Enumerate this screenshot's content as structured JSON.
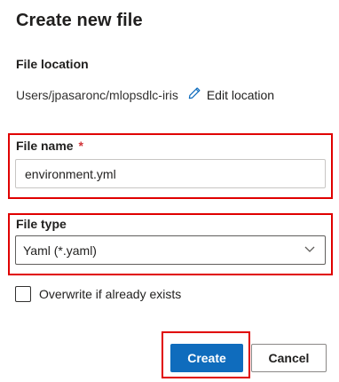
{
  "dialog": {
    "title": "Create new file",
    "file_location": {
      "label": "File location",
      "path": "Users/jpasaronc/mlopsdlc-iris",
      "edit_label": "Edit location"
    },
    "file_name": {
      "label": "File name",
      "required_marker": "*",
      "value": "environment.yml"
    },
    "file_type": {
      "label": "File type",
      "selected": "Yaml (*.yaml)"
    },
    "overwrite": {
      "label": "Overwrite if already exists",
      "checked": false
    },
    "buttons": {
      "create": "Create",
      "cancel": "Cancel"
    }
  },
  "colors": {
    "primary": "#0f6cbd",
    "highlight": "#e00000",
    "required": "#d13438"
  },
  "icons": {
    "edit": "pencil-icon",
    "dropdown": "chevron-down-icon"
  }
}
